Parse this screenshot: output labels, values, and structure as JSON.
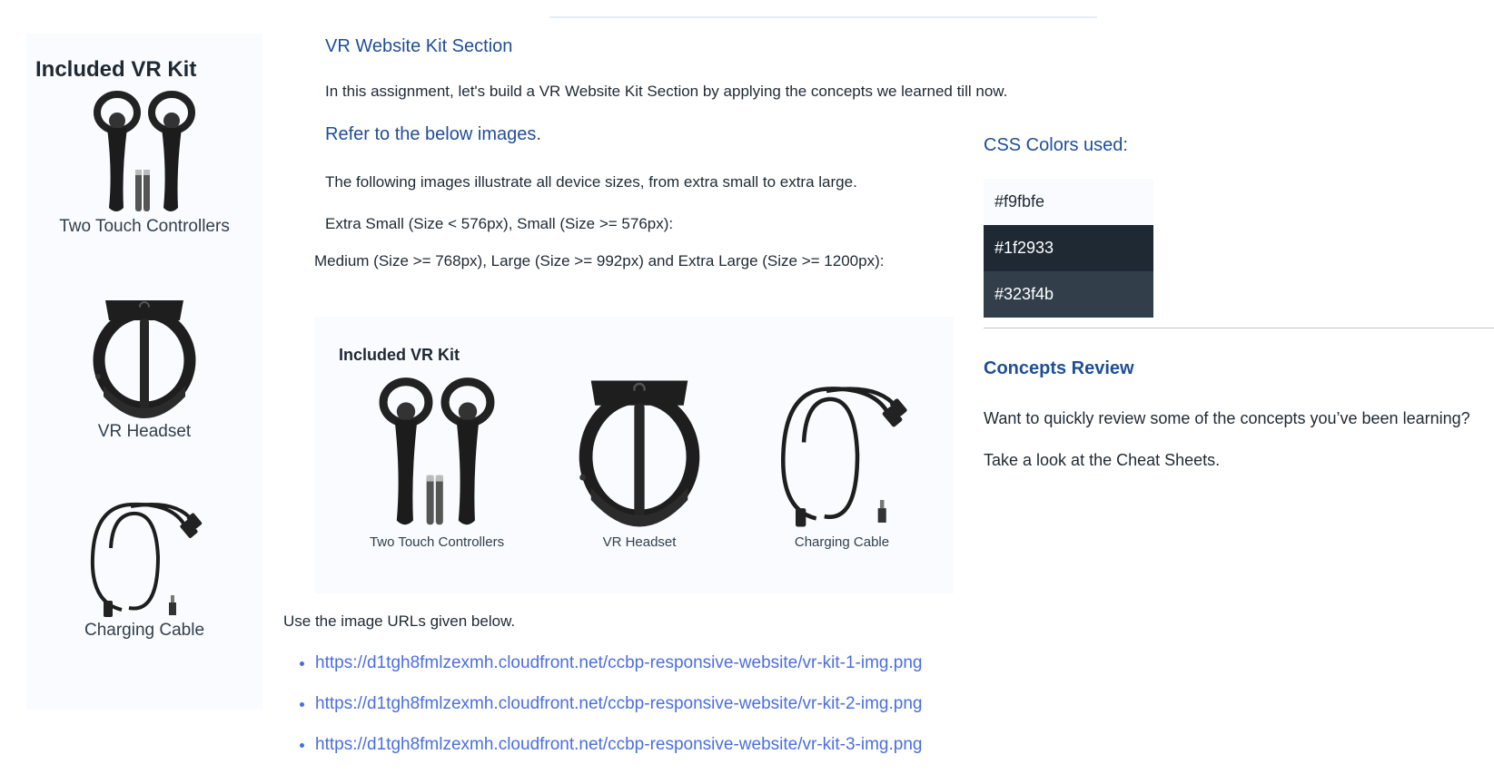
{
  "kit_panel": {
    "title": "Included VR Kit",
    "items": [
      {
        "caption": "Two Touch Controllers",
        "icon": "touch-controllers-image"
      },
      {
        "caption": "VR Headset",
        "icon": "vr-headset-image"
      },
      {
        "caption": "Charging Cable",
        "icon": "charging-cable-image"
      }
    ]
  },
  "main": {
    "heading": "VR Website Kit Section",
    "intro": "In this assignment, let's build a VR Website Kit Section by applying the concepts we learned till now.",
    "refer_heading": "Refer to the below images.",
    "device_text": "The following images illustrate all device sizes, from extra small to extra large.",
    "small_sizes": "Extra Small (Size < 576px), Small (Size >= 576px):",
    "large_sizes": "Medium (Size >= 768px), Large (Size >= 992px) and Extra Large (Size >= 1200px):",
    "preview": {
      "title": "Included VR Kit",
      "items": [
        {
          "caption": "Two Touch Controllers"
        },
        {
          "caption": "VR Headset"
        },
        {
          "caption": "Charging Cable"
        }
      ]
    },
    "urls_intro": "Use the image URLs given below.",
    "urls": [
      "https://d1tgh8fmlzexmh.cloudfront.net/ccbp-responsive-website/vr-kit-1-img.png",
      "https://d1tgh8fmlzexmh.cloudfront.net/ccbp-responsive-website/vr-kit-2-img.png",
      "https://d1tgh8fmlzexmh.cloudfront.net/ccbp-responsive-website/vr-kit-3-img.png"
    ]
  },
  "sidebar_right": {
    "colors_heading": "CSS Colors used:",
    "colors": [
      {
        "hex": "#f9fbfe",
        "text_color": "#1f2933"
      },
      {
        "hex": "#1f2933",
        "text_color": "#ffffff"
      },
      {
        "hex": "#323f4b",
        "text_color": "#ffffff"
      }
    ],
    "concepts_heading": "Concepts Review",
    "concepts_text": "Want to quickly review some of the concepts you’ve been learning?",
    "cheat_text": "Take a look at the Cheat Sheets."
  },
  "theme": {
    "heading_color": "#1f4e96",
    "link_color": "#4a6ee0"
  }
}
